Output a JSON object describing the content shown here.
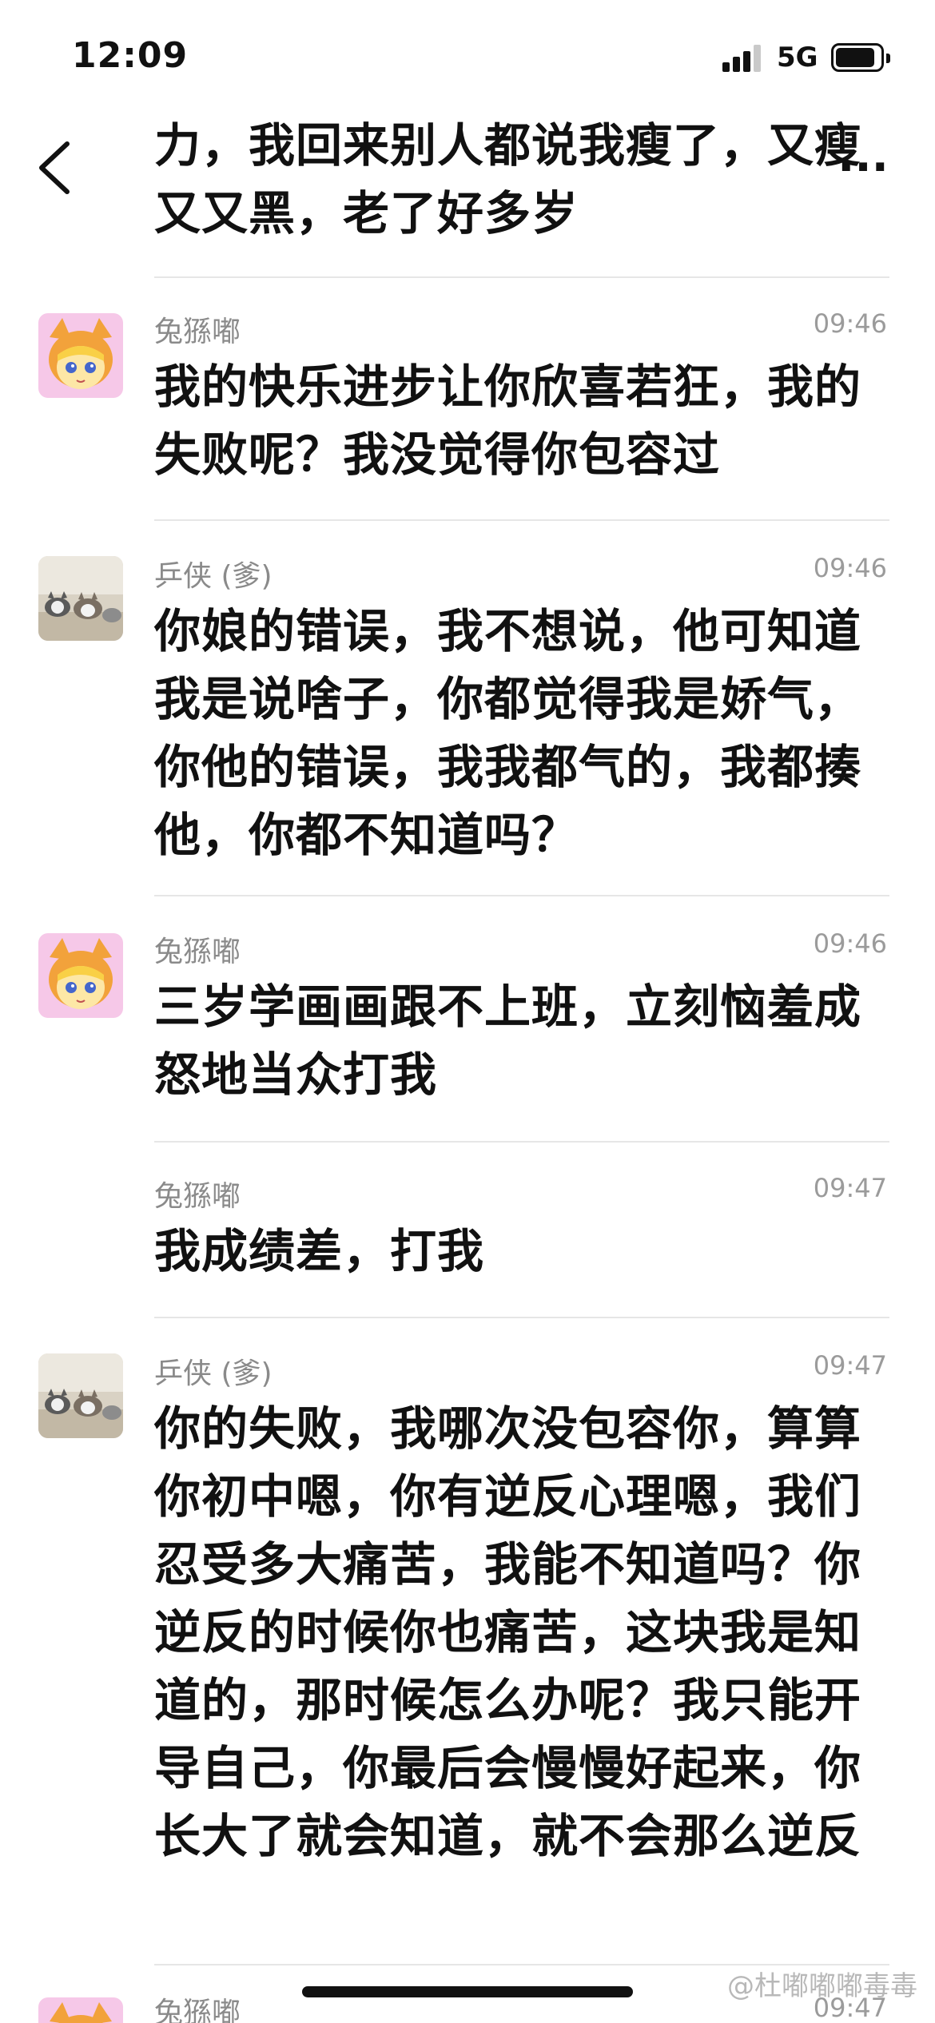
{
  "status_bar": {
    "time": "12:09",
    "network": "5G"
  },
  "partial_top_message": "力，我回来别人都说我瘦了，又瘦又又黑，老了好多岁",
  "more_label": "...",
  "messages": [
    {
      "sender": "兔猻嘟",
      "time": "09:46",
      "text": "我的快乐进步让你欣喜若狂，我的失败呢？我没觉得你包容过",
      "avatar": "cartoon-fox-avatar"
    },
    {
      "sender": "乒侠 (爹)",
      "time": "09:46",
      "text": "你娘的错误，我不想说，他可知道我是说啥子，你都觉得我是娇气，你他的错误，我我都气的，我都揍他，你都不知道吗？",
      "avatar": "cats-photo-avatar"
    },
    {
      "sender": "兔猻嘟",
      "time": "09:46",
      "text": "三岁学画画跟不上班，立刻恼羞成怒地当众打我",
      "avatar": "cartoon-fox-avatar"
    },
    {
      "sender": "兔猻嘟",
      "time": "09:47",
      "text": "我成绩差，打我",
      "avatar": ""
    },
    {
      "sender": "乒侠 (爹)",
      "time": "09:47",
      "text": "你的失败，我哪次没包容你，算算你初中嗯，你有逆反心理嗯，我们忍受多大痛苦，我能不知道吗？你逆反的时候你也痛苦，这块我是知道的，那时候怎么办呢？我只能开导自己，你最后会慢慢好起来，你长大了就会知道，就不会那么逆反",
      "avatar": "cats-photo-avatar"
    },
    {
      "sender": "兔猻嘟",
      "time": "09:47",
      "text": "",
      "avatar": "cartoon-fox-avatar"
    }
  ],
  "watermark": "@杜嘟嘟嘟毒毒",
  "colors": {
    "sender": "#8a8a8a",
    "timestamp": "#9b9b9b",
    "divider": "#e6e6e6"
  }
}
